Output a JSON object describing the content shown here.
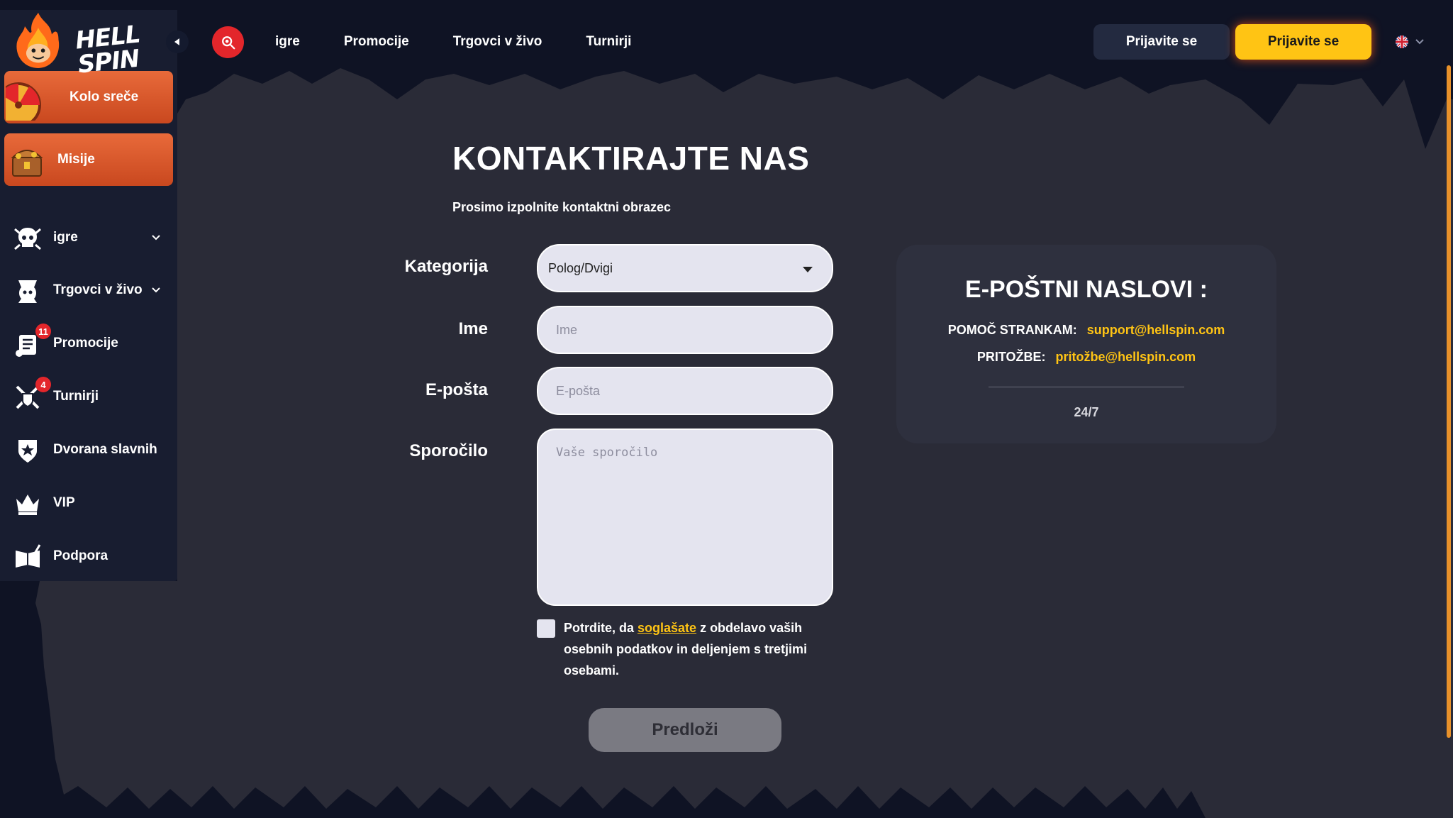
{
  "header": {
    "logo_line1": "HELL",
    "logo_line2": "SPIN",
    "nav": [
      "igre",
      "Promocije",
      "Trgovci v živo",
      "Turnirji"
    ],
    "login_label": "Prijavite se",
    "register_label": "Prijavite se",
    "language_icon": "uk-flag-icon"
  },
  "sidebar": {
    "tiles": [
      {
        "label": "Kolo sreče",
        "icon": "wheel-of-fortune-icon"
      },
      {
        "label": "Misije",
        "icon": "treasure-chest-icon"
      }
    ],
    "items": [
      {
        "label": "igre",
        "icon": "skull-icon",
        "expandable": true
      },
      {
        "label": "Trgovci v živo",
        "icon": "dealer-icon",
        "expandable": true
      },
      {
        "label": "Promocije",
        "icon": "scroll-icon",
        "badge": "11"
      },
      {
        "label": "Turnirji",
        "icon": "crossed-swords-icon",
        "badge": "4"
      },
      {
        "label": "Dvorana slavnih",
        "icon": "shield-star-icon"
      },
      {
        "label": "VIP",
        "icon": "crown-icon"
      },
      {
        "label": "Podpora",
        "icon": "book-quill-icon"
      }
    ]
  },
  "main": {
    "title": "KONTAKTIRAJTE NAS",
    "subtitle": "Prosimo izpolnite kontaktni obrazec",
    "form": {
      "category_label": "Kategorija",
      "category_value": "Polog/Dvigi",
      "name_label": "Ime",
      "name_placeholder": "Ime",
      "email_label": "E-pošta",
      "email_placeholder": "E-pošta",
      "message_label": "Sporočilo",
      "message_placeholder": "Vaše sporočilo",
      "consent_before": "Potrdite, da ",
      "consent_link": "soglašate",
      "consent_after": " z obdelavo vaših osebnih podatkov in deljenjem s tretjimi osebami.",
      "submit_label": "Predloži"
    }
  },
  "contact_card": {
    "title": "E-POŠTNI NASLOVI :",
    "support_key": "POMOČ STRANKAM:",
    "support_email": "support@hellspin.com",
    "complaints_key": "PRITOŽBE:",
    "complaints_email": "pritožbe@hellspin.com",
    "hours": "24/7"
  },
  "colors": {
    "background": "#0f1324",
    "panel": "#2e303e",
    "accent_yellow": "#ffc414",
    "accent_red": "#e3262b",
    "tile_orange": "#d9582a"
  }
}
